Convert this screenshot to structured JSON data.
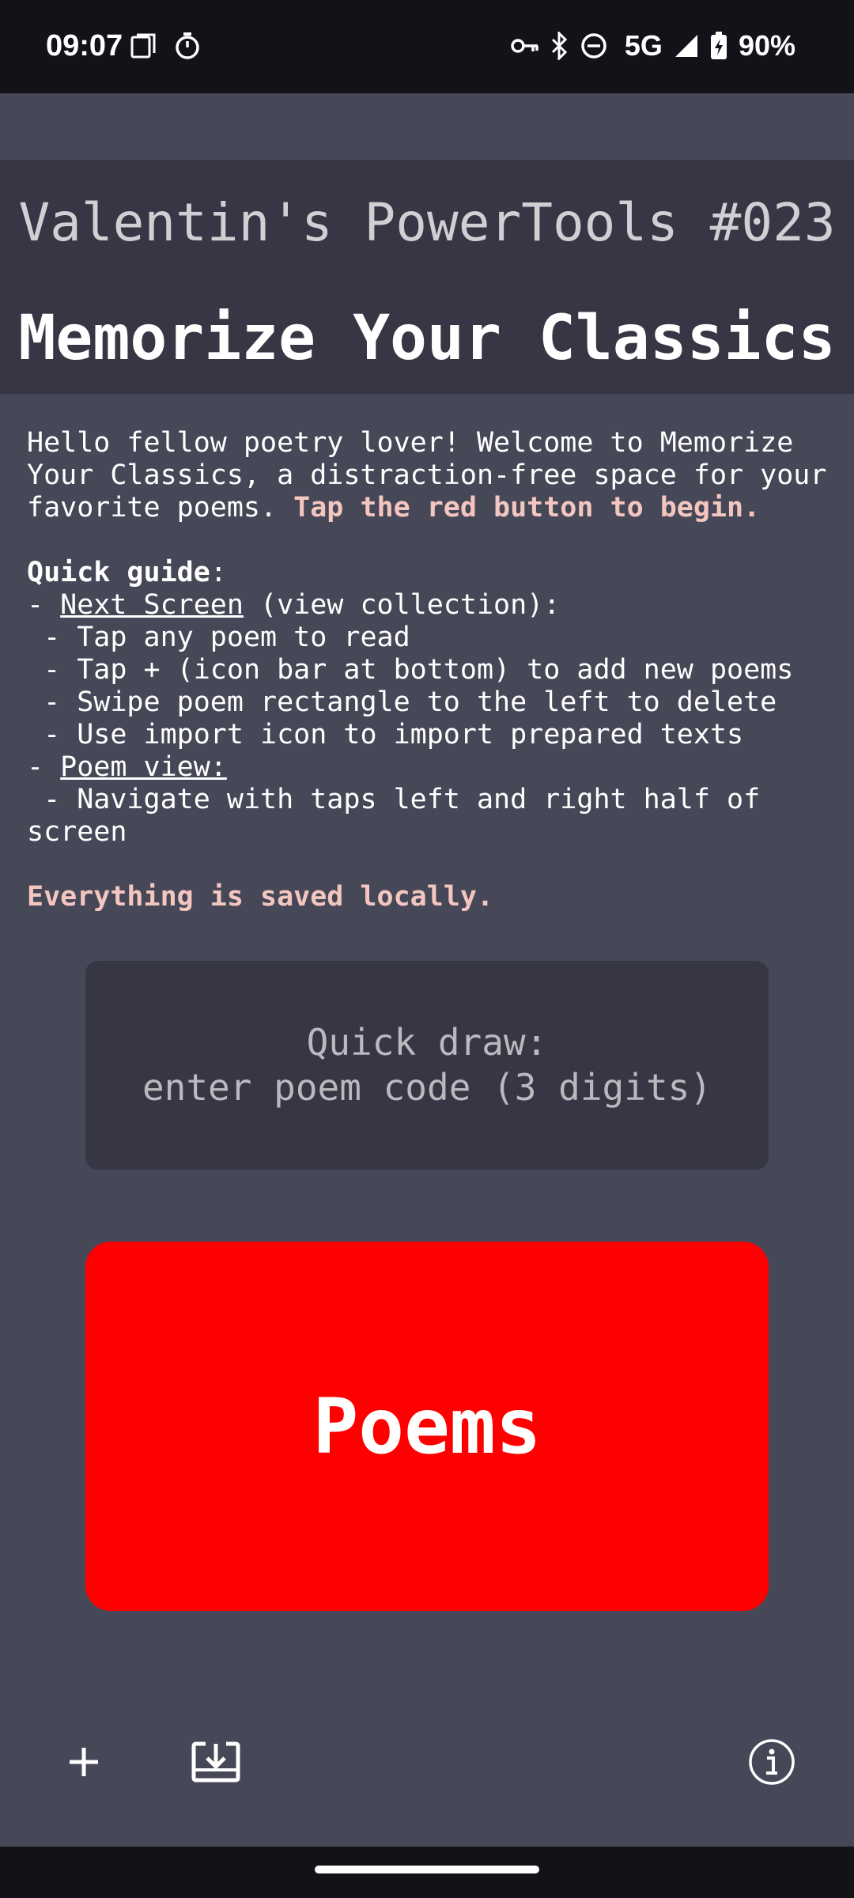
{
  "status_bar": {
    "time": "09:07",
    "network": "5G",
    "battery": "90%",
    "icons_left": [
      "screenshot-icon",
      "timer-icon"
    ],
    "icons_right": [
      "vpn-key-icon",
      "bluetooth-icon",
      "dnd-icon",
      "signal-icon",
      "battery-charging-icon"
    ]
  },
  "header": {
    "subtitle": "Valentin's PowerTools #023",
    "title": "Memorize Your Classics"
  },
  "intro": {
    "welcome": "Hello fellow poetry lover! Welcome to Memorize Your Classics, a distraction-free space for your favorite poems. ",
    "cta": "Tap the red button to begin.",
    "guide_heading": "Quick guide",
    "guide_colon": ":",
    "dash": "- ",
    "next_screen_label": "Next Screen",
    "next_screen_note": " (view collection):",
    "items_next": [
      " - Tap any poem to read",
      " - Tap + (icon bar at bottom) to add new poems",
      " - Swipe poem rectangle to the left to delete",
      " - Use import icon to import prepared texts"
    ],
    "poem_view_label": "Poem view:",
    "items_poem": [
      " - Navigate with taps left and right half of screen"
    ],
    "saved_note": "Everything is saved locally."
  },
  "quick_draw": {
    "placeholder": "Quick draw:\nenter poem code (3 digits)"
  },
  "poems_button": {
    "label": "Poems"
  },
  "bottom_bar": {
    "icons": [
      "add-icon",
      "import-icon",
      "info-icon"
    ]
  },
  "colors": {
    "background": "#464757",
    "header_bg": "#363644",
    "accent_text": "#f4c6c0",
    "primary_button": "#ff0000"
  }
}
